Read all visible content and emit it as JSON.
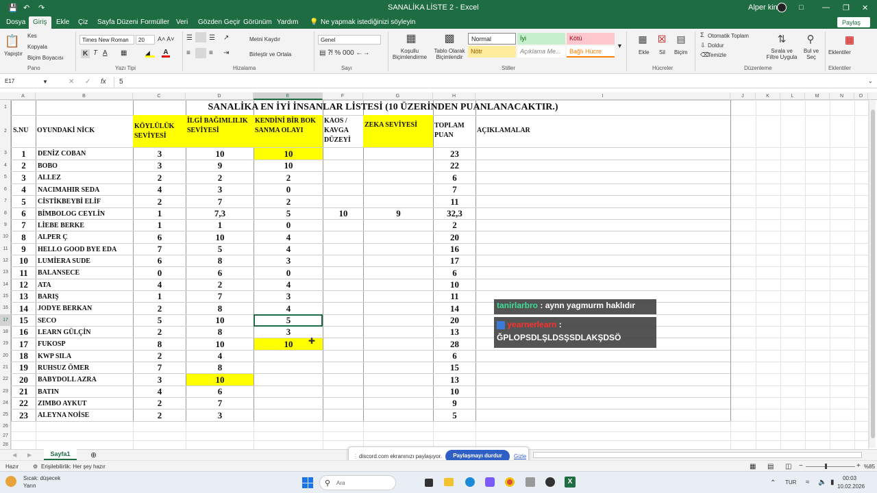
{
  "titlebar": {
    "title": "SANALİKA LİSTE 2  -  Excel",
    "user": "Alper king"
  },
  "menu": [
    "Dosya",
    "Giriş",
    "Ekle",
    "Çiz",
    "Sayfa Düzeni",
    "Formüller",
    "Veri",
    "Gözden Geçir",
    "Görünüm",
    "Yardım"
  ],
  "tell_me": "Ne yapmak istediğinizi söyleyin",
  "share": "Paylaş",
  "ribbon": {
    "clipboard": {
      "paste": "Yapıştır",
      "cut": "Kes",
      "copy": "Kopyala",
      "painter": "Biçim Boyacısı",
      "group": "Pano"
    },
    "font": {
      "name": "Times New Roman",
      "size": "20",
      "group": "Yazı Tipi"
    },
    "align": {
      "wrap": "Metni Kaydır",
      "merge": "Birleştir ve Ortala",
      "group": "Hizalama"
    },
    "number": {
      "format": "Genel",
      "group": "Sayı"
    },
    "styles": {
      "cond": "Koşullu Biçimlendirme",
      "table": "Tablo Olarak Biçimlendir",
      "normal": "Normal",
      "iyi": "İyi",
      "kotu": "Kötü",
      "notr": "Nötr",
      "aciklama": "Açıklama Me...",
      "bagli": "Bağlı Hücre",
      "group": "Stiller"
    },
    "cells": {
      "insert": "Ekle",
      "delete": "Sil",
      "format": "Biçim",
      "group": "Hücreler"
    },
    "editing": {
      "autosum": "Otomatik Toplam",
      "fill": "Doldur",
      "clear": "Temizle",
      "sort": "Sırala ve Filtre Uygula",
      "find": "Bul ve Seç",
      "group": "Düzenleme"
    },
    "addins": {
      "label": "Eklentiler",
      "group": "Eklentiler"
    }
  },
  "formula": {
    "namebox": "E17",
    "fx": "fx",
    "value": "5"
  },
  "columns": [
    "A",
    "B",
    "C",
    "D",
    "E",
    "F",
    "G",
    "H",
    "I",
    "J",
    "K",
    "L",
    "M",
    "N",
    "O"
  ],
  "sheet": {
    "title": "SANALİKA EN İYİ İNSANLAR LİSTESİ  (10 ÜZERİNDEN PUANLANACAKTIR.)",
    "headers": [
      "S.NU",
      "OYUNDAKİ NİCK",
      "KÖYLÜLÜK SEVİYESİ",
      "İLGİ BAĞIMLILIK SEVİYESİ",
      "KENDİNİ BİR BOK SANMA OLAYI",
      "KAOS / KAVGA DÜZEYİ",
      "ZEKA SEVİYESİ",
      "TOPLAM PUAN",
      "AÇIKLAMALAR"
    ],
    "rows": [
      [
        "1",
        "DENİZ COBAN",
        "3",
        "10",
        "10",
        "",
        "",
        "23"
      ],
      [
        "2",
        "BOBO",
        "3",
        "9",
        "10",
        "",
        "",
        "22"
      ],
      [
        "3",
        "ALLEZ",
        "2",
        "2",
        "2",
        "",
        "",
        "6"
      ],
      [
        "4",
        "NACIMAHIR SEDA",
        "4",
        "3",
        "0",
        "",
        "",
        "7"
      ],
      [
        "5",
        "CİSTİKBEYBİ ELİF",
        "2",
        "7",
        "2",
        "",
        "",
        "11"
      ],
      [
        "6",
        "BİMBOLOG CEYLİN",
        "1",
        "7,3",
        "5",
        "10",
        "9",
        "32,3"
      ],
      [
        "7",
        "LİEBE BERKE",
        "1",
        "1",
        "0",
        "",
        "",
        "2"
      ],
      [
        "8",
        "ALPER Ç",
        "6",
        "10",
        "4",
        "",
        "",
        "20"
      ],
      [
        "9",
        "HELLO GOOD BYE EDA",
        "7",
        "5",
        "4",
        "",
        "",
        "16"
      ],
      [
        "10",
        "LUMİERA SUDE",
        "6",
        "8",
        "3",
        "",
        "",
        "17"
      ],
      [
        "11",
        "BALANSECE",
        "0",
        "6",
        "0",
        "",
        "",
        "6"
      ],
      [
        "12",
        "ATA",
        "4",
        "2",
        "4",
        "",
        "",
        "10"
      ],
      [
        "13",
        "BARIŞ",
        "1",
        "7",
        "3",
        "",
        "",
        "11"
      ],
      [
        "14",
        "JODYE BERKAN",
        "2",
        "8",
        "4",
        "",
        "",
        "14"
      ],
      [
        "15",
        "SECO",
        "5",
        "10",
        "5",
        "",
        "",
        "20"
      ],
      [
        "16",
        "LEARN GÜLÇİN",
        "2",
        "8",
        "3",
        "",
        "",
        "13"
      ],
      [
        "17",
        "FUKOSP",
        "8",
        "10",
        "10",
        "",
        "",
        "28"
      ],
      [
        "18",
        "KWP SILA",
        "2",
        "4",
        "",
        "",
        "",
        "6"
      ],
      [
        "19",
        "RUHSUZ ÖMER",
        "7",
        "8",
        "",
        "",
        "",
        "15"
      ],
      [
        "20",
        "BABYDOLL AZRA",
        "3",
        "10",
        "",
        "",
        "",
        "13"
      ],
      [
        "21",
        "BATIN",
        "4",
        "6",
        "",
        "",
        "",
        "10"
      ],
      [
        "22",
        "ZIMBO AYKUT",
        "2",
        "7",
        "",
        "",
        "",
        "9"
      ],
      [
        "23",
        "ALEYNA NOİSE",
        "2",
        "3",
        "",
        "",
        "",
        "5"
      ]
    ]
  },
  "rownums": [
    "1",
    "2",
    "3",
    "4",
    "5",
    "6",
    "7",
    "8",
    "9",
    "10",
    "11",
    "12",
    "13",
    "14",
    "15",
    "16",
    "17",
    "18",
    "19",
    "20",
    "21",
    "22",
    "23",
    "24",
    "25",
    "26",
    "27",
    "28"
  ],
  "overlay": {
    "user1": "tanirlarbro",
    "msg1": ": aynn yagmurm haklıdır",
    "user2": "yearnerlearn",
    "msg2a": ":",
    "msg2b": "ĞPLOPSDLŞLDSŞSDLAKŞDSÖ"
  },
  "sheettab": "Sayfa1",
  "share_banner": {
    "text": "discord.com ekranınızı paylaşıyor.",
    "button": "Paylaşmayı durdur",
    "hide": "Gizle"
  },
  "status": {
    "ready": "Hazır",
    "access": "Erişilebilirlik: Her şey hazır",
    "zoom": "%85"
  },
  "taskbar": {
    "weather_t": "Sıcak: düşecek",
    "weather_s": "Yarın",
    "search": "Ara",
    "lang": "TUR",
    "time": "00:03",
    "date": "10.02.2026"
  },
  "colors": {
    "excel_green": "#1e6c41",
    "highlight": "#ffff00"
  }
}
